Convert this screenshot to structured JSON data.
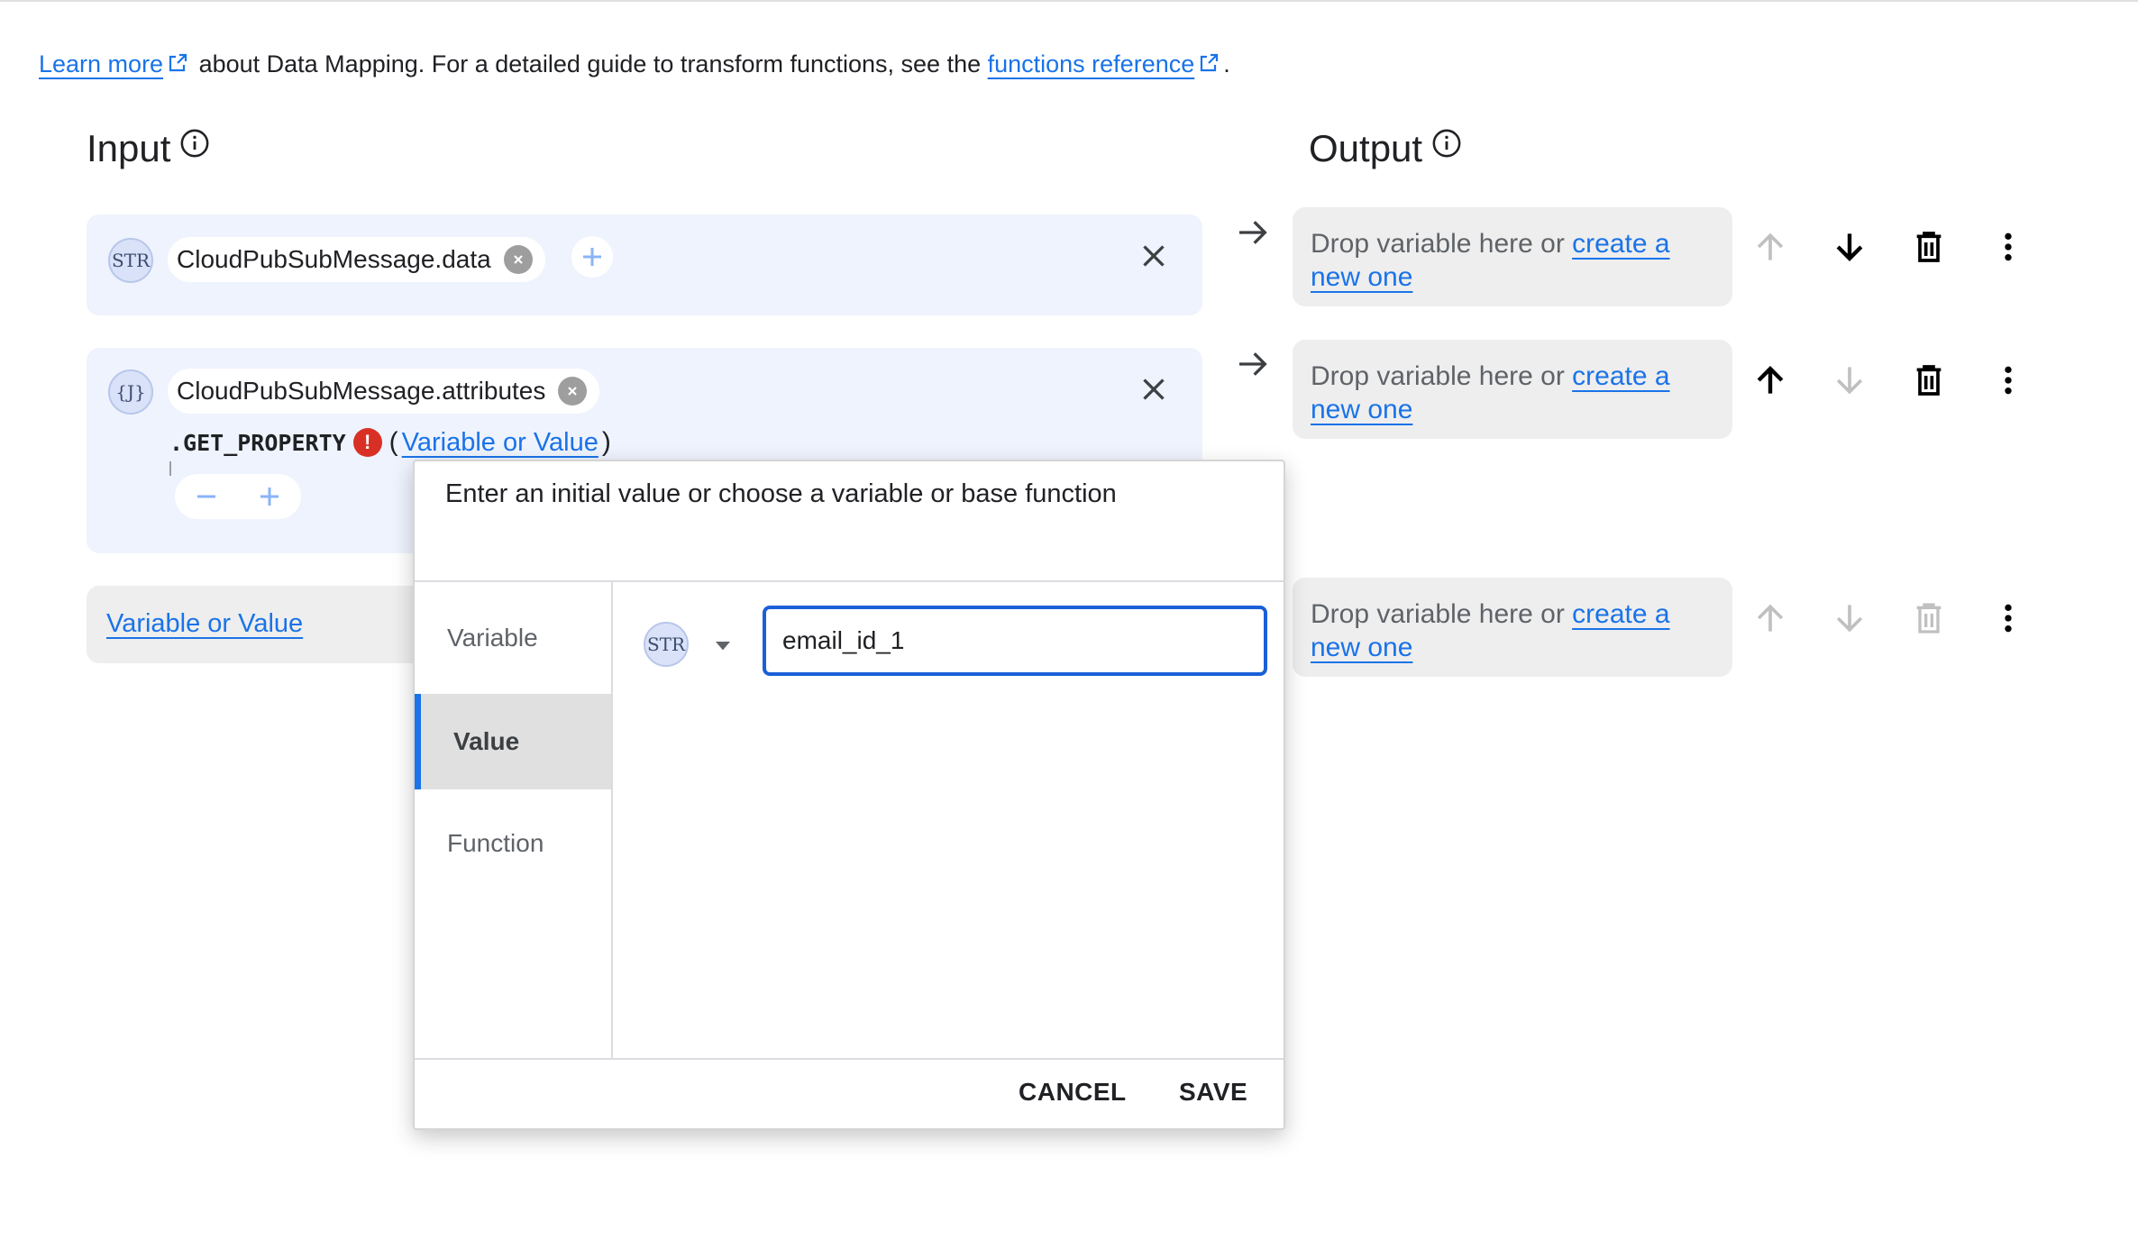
{
  "intro": {
    "learn_more": "Learn more",
    "middle": " about Data Mapping. For a detailed guide to transform functions, see the ",
    "functions_reference": "functions reference",
    "end": "."
  },
  "input": {
    "title": "Input",
    "rows": [
      {
        "type_badge": "STR",
        "variable": "CloudPubSubMessage.data"
      },
      {
        "type_badge": "{J}",
        "variable": "CloudPubSubMessage.attributes",
        "function": ".GET_PROPERTY",
        "error_mark": "!",
        "open_paren": "(",
        "arg": "Variable or Value",
        "close_paren": ")"
      }
    ],
    "empty_row": "Variable or Value"
  },
  "output": {
    "title": "Output",
    "rows": [
      {
        "prefix": "Drop variable here or ",
        "link_1": "create a",
        "link_2": "new one"
      },
      {
        "prefix": "Drop variable here or ",
        "link_1": "create a",
        "link_2": "new one"
      },
      {
        "prefix": "Drop variable here or ",
        "link_1": "create a",
        "link_2": "new one"
      }
    ]
  },
  "dialog": {
    "title": "Enter an initial value or choose a variable or base function",
    "tabs": [
      "Variable",
      "Value",
      "Function"
    ],
    "active_tab": "Value",
    "type_badge": "STR",
    "value": "email_id_1",
    "cancel": "CANCEL",
    "save": "SAVE"
  },
  "colors": {
    "link": "#1a73e8",
    "input_row_bg": "#eef3fd",
    "output_box_bg": "#eeeeee",
    "error": "#d93025",
    "active_tab_indicator": "#1a73e8"
  },
  "icons": [
    "external-link-icon",
    "info-icon",
    "close-icon",
    "remove-chip-icon",
    "plus-icon",
    "minus-icon",
    "arrow-right-icon",
    "arrow-up-icon",
    "arrow-down-icon",
    "delete-icon",
    "more-vert-icon",
    "dropdown-icon",
    "error-icon"
  ]
}
